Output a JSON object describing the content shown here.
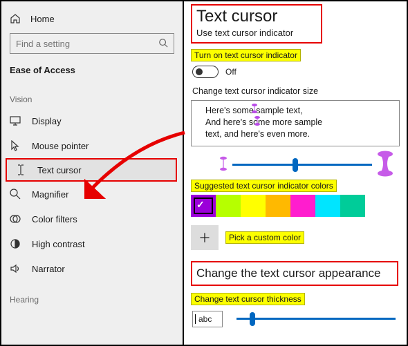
{
  "sidebar": {
    "home": "Home",
    "search_placeholder": "Find a setting",
    "section": "Ease of Access",
    "groups": [
      {
        "label": "Vision",
        "items": [
          {
            "id": "display",
            "label": "Display"
          },
          {
            "id": "mouse-pointer",
            "label": "Mouse pointer"
          },
          {
            "id": "text-cursor",
            "label": "Text cursor",
            "active": true
          },
          {
            "id": "magnifier",
            "label": "Magnifier"
          },
          {
            "id": "color-filters",
            "label": "Color filters"
          },
          {
            "id": "high-contrast",
            "label": "High contrast"
          },
          {
            "id": "narrator",
            "label": "Narrator"
          }
        ]
      },
      {
        "label": "Hearing",
        "items": []
      }
    ]
  },
  "main": {
    "title": "Text cursor",
    "subtitle": "Use text cursor indicator",
    "indicator": {
      "callout": "Turn on text cursor indicator",
      "toggle_state": "Off",
      "size_label": "Change text cursor indicator size",
      "sample_lines": [
        "Here's some sample text,",
        "And here's some more sample",
        "text, and here's even more."
      ],
      "slider_value": 45,
      "colors_callout": "Suggested text cursor indicator colors",
      "colors": [
        {
          "name": "purple",
          "hex": "#9b00d9",
          "selected": true
        },
        {
          "name": "lime",
          "hex": "#b6ff00"
        },
        {
          "name": "yellow",
          "hex": "#ffff00"
        },
        {
          "name": "gold",
          "hex": "#ffb900"
        },
        {
          "name": "magenta",
          "hex": "#ff1dce"
        },
        {
          "name": "cyan",
          "hex": "#00e5ff"
        },
        {
          "name": "teal",
          "hex": "#00cc99"
        }
      ],
      "custom_label": "Pick a custom color"
    },
    "appearance": {
      "heading": "Change the text cursor appearance",
      "thickness_callout": "Change text cursor thickness",
      "abc_sample": "abc",
      "thickness_value": 10
    }
  }
}
